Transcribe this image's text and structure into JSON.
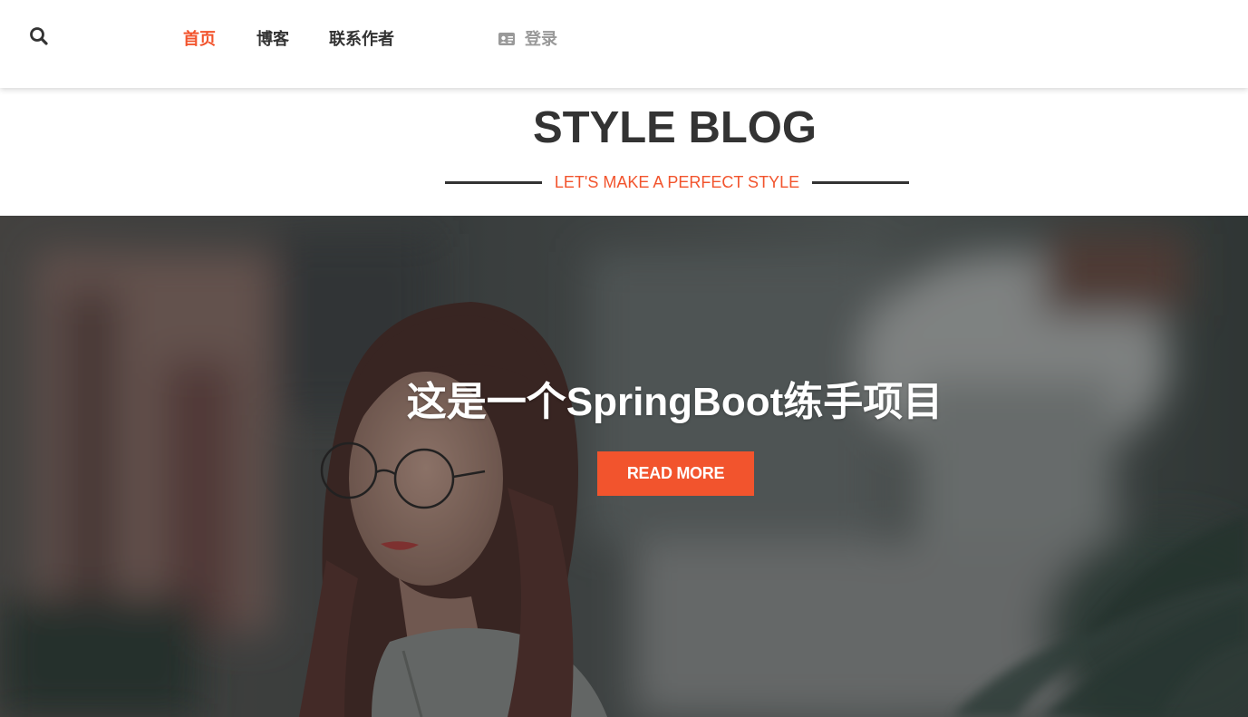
{
  "nav": {
    "items": [
      {
        "label": "首页",
        "active": true
      },
      {
        "label": "博客",
        "active": false
      },
      {
        "label": "联系作者",
        "active": false
      }
    ],
    "login_label": "登录",
    "search_icon": "search-icon",
    "login_icon": "id-card-icon"
  },
  "brand": {
    "title": "STYLE BLOG",
    "tagline": "LET'S MAKE A PERFECT STYLE"
  },
  "hero": {
    "title": "这是一个SpringBoot练手项目",
    "button_label": "READ MORE"
  },
  "colors": {
    "accent": "#f2542d",
    "text_dark": "#333333",
    "text_muted": "#999999"
  }
}
